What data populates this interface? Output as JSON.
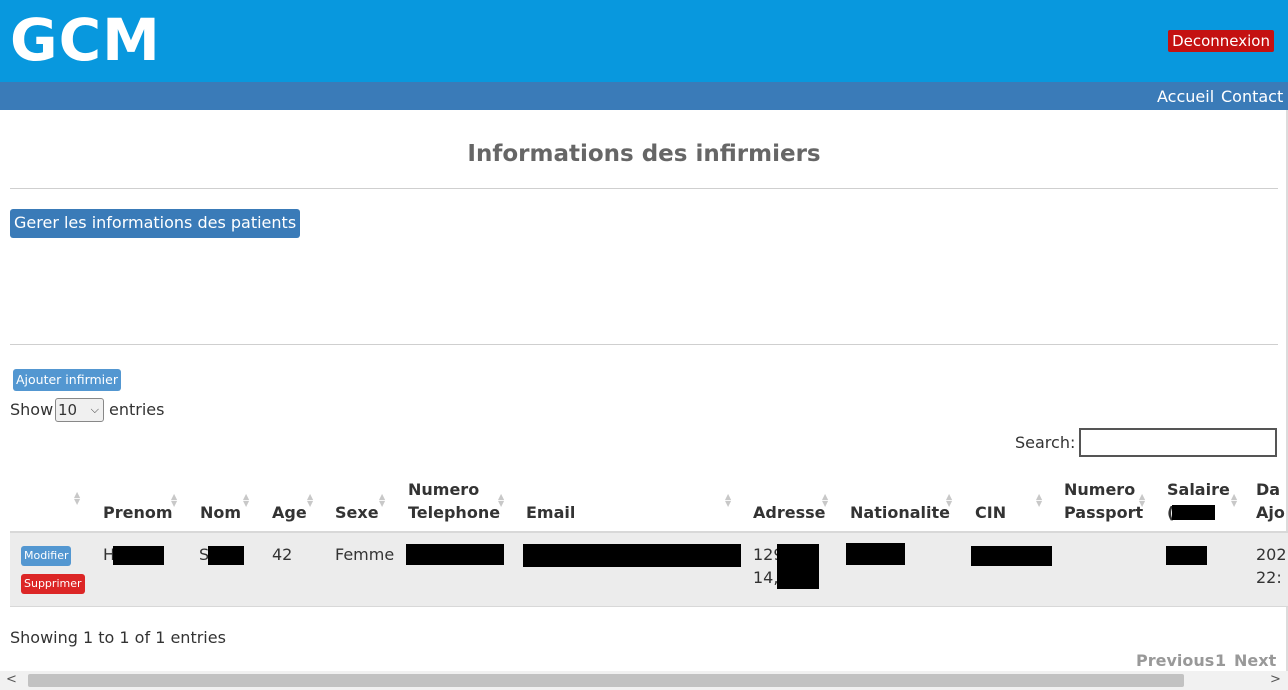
{
  "header": {
    "logo": "GCM",
    "logout_label": "Deconnexion",
    "nav": [
      "Accueil",
      "Contact"
    ]
  },
  "page": {
    "title": "Informations des infirmiers",
    "manage_patients_button": "Gerer les informations des patients",
    "add_button": "Ajouter infirmier"
  },
  "table_controls": {
    "show_label": "Show",
    "length_value": "10",
    "entries_label": "entries",
    "search_label": "Search:",
    "search_value": ""
  },
  "table": {
    "columns": [
      "Prenom",
      "Nom",
      "Age",
      "Sexe",
      "Numero Telephone",
      "Email",
      "Adresse",
      "Nationalite",
      "CIN",
      "Numero Passport",
      "Salaire",
      "Date Ajout"
    ],
    "column_lines": {
      "numero_telephone": [
        "Numero",
        "Telephone"
      ],
      "numero_passport": [
        "Numero",
        "Passport"
      ],
      "salaire": [
        "Salaire",
        "("
      ],
      "date_ajout": [
        "Da",
        "Ajo"
      ]
    },
    "rows": [
      {
        "actions": [
          "Modifier",
          "Supprimer"
        ],
        "prenom": "H",
        "nom": "S",
        "age": "42",
        "sexe": "Femme",
        "numero_telephone": "",
        "email": "",
        "adresse_lines": [
          "129",
          "14,"
        ],
        "nationalite": "",
        "cin": "",
        "numero_passport": "",
        "salaire": "",
        "date_lines": [
          "202",
          "22:"
        ]
      }
    ]
  },
  "footer": {
    "info": "Showing 1 to 1 of 1 entries",
    "previous": "Previous",
    "page": "1",
    "next": "Next"
  },
  "colors": {
    "topbar": "#0898de",
    "navbar": "#3a7bb8",
    "logout": "#c41111",
    "delete": "#dc2626",
    "edit": "#5397d1"
  }
}
